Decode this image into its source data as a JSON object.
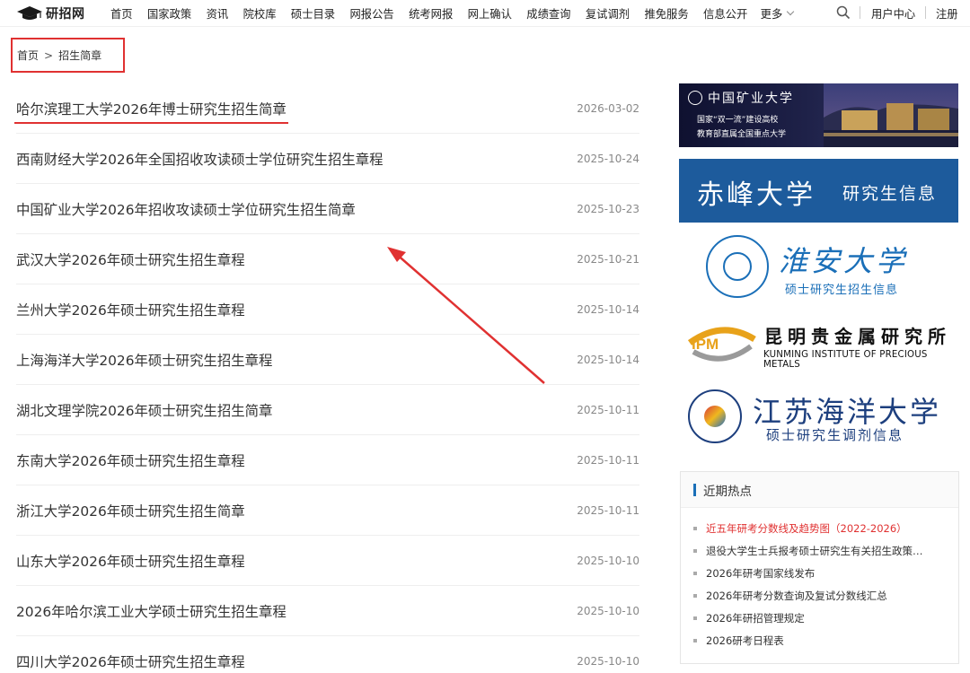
{
  "site": {
    "name": "研招网"
  },
  "nav": {
    "items": [
      "首页",
      "国家政策",
      "资讯",
      "院校库",
      "硕士目录",
      "网报公告",
      "统考网报",
      "网上确认",
      "成绩查询",
      "复试调剂",
      "推免服务",
      "信息公开"
    ],
    "more": "更多",
    "user_center": "用户中心",
    "register": "注册"
  },
  "breadcrumb": {
    "home": "首页",
    "sep": ">",
    "current": "招生简章"
  },
  "articles": [
    {
      "title": "哈尔滨理工大学2026年博士研究生招生简章",
      "date": "2026-03-02"
    },
    {
      "title": "西南财经大学2026年全国招收攻读硕士学位研究生招生章程",
      "date": "2025-10-24"
    },
    {
      "title": "中国矿业大学2026年招收攻读硕士学位研究生招生简章",
      "date": "2025-10-23"
    },
    {
      "title": "武汉大学2026年硕士研究生招生章程",
      "date": "2025-10-21"
    },
    {
      "title": "兰州大学2026年硕士研究生招生章程",
      "date": "2025-10-14"
    },
    {
      "title": "上海海洋大学2026年硕士研究生招生章程",
      "date": "2025-10-14"
    },
    {
      "title": "湖北文理学院2026年硕士研究生招生简章",
      "date": "2025-10-11"
    },
    {
      "title": "东南大学2026年硕士研究生招生章程",
      "date": "2025-10-11"
    },
    {
      "title": "浙江大学2026年硕士研究生招生简章",
      "date": "2025-10-11"
    },
    {
      "title": "山东大学2026年硕士研究生招生章程",
      "date": "2025-10-10"
    },
    {
      "title": "2026年哈尔滨工业大学硕士研究生招生章程",
      "date": "2025-10-10"
    },
    {
      "title": "四川大学2026年硕士研究生招生章程",
      "date": "2025-10-10"
    }
  ],
  "banners": {
    "cumt": {
      "name": "中国矿业大学",
      "line1": "国家“双一流”建设高校",
      "line2": "教育部直属全国重点大学"
    },
    "chifeng": {
      "big": "赤峰大学",
      "small": "研究生信息"
    },
    "huaian": {
      "big": "淮安大学",
      "small": "硕士研究生招生信息"
    },
    "ipm": {
      "logo": "IPM",
      "cn": "昆明贵金属研究所",
      "en": "KUNMING INSTITUTE OF PRECIOUS METALS"
    },
    "jiangsu": {
      "big": "江苏海洋大学",
      "small": "硕士研究生调剂信息"
    }
  },
  "hot": {
    "title": "近期热点",
    "items": [
      "近五年研考分数线及趋势图（2022-2026）",
      "退役大学生士兵报考硕士研究生有关招生政策…",
      "2026年研考国家线发布",
      "2026年研考分数查询及复试分数线汇总",
      "2026年研招管理规定",
      "2026研考日程表"
    ]
  },
  "colors": {
    "accent_red": "#e03131",
    "link_blue": "#1a6fb8"
  }
}
